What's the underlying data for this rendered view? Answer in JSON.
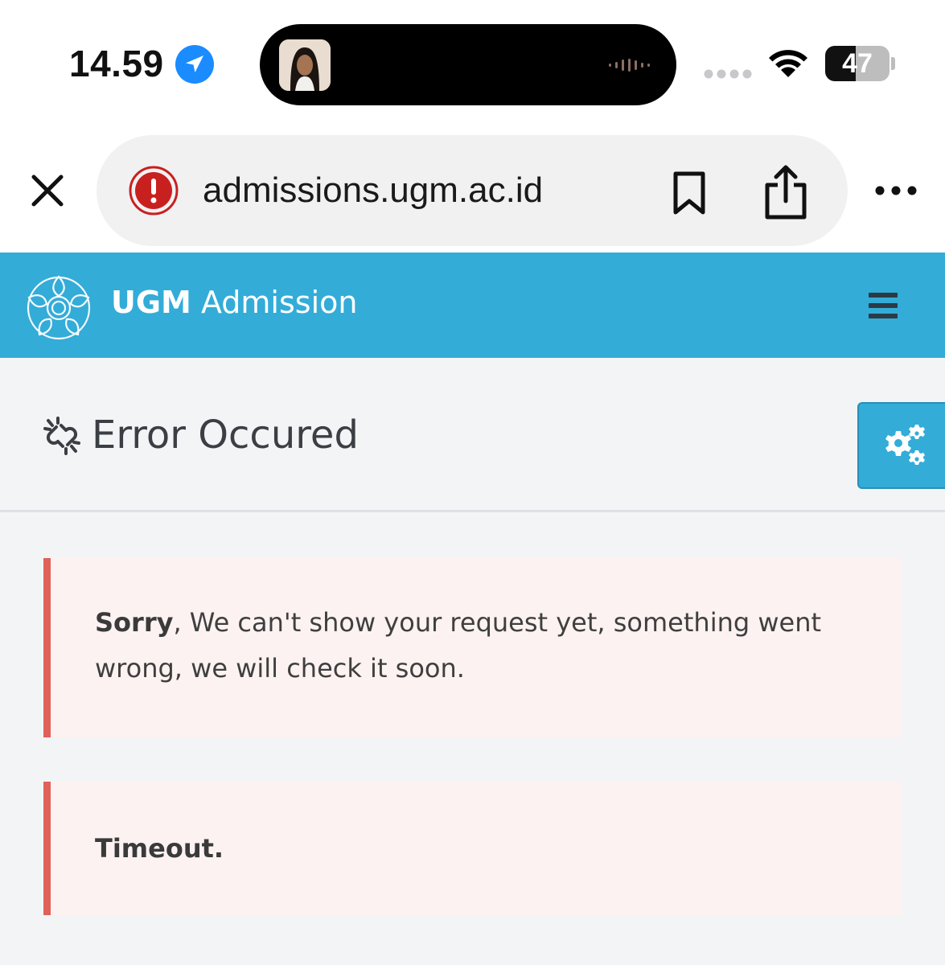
{
  "status_bar": {
    "time": "14.59",
    "battery": "47",
    "battery_level": 0.47,
    "icons": [
      "location-arrow-icon",
      "wifi-icon",
      "battery-icon",
      "signal-dots-icon"
    ]
  },
  "browser": {
    "url": "admissions.ugm.ac.id",
    "icons": [
      "close-icon",
      "warning-icon",
      "bookmark-icon",
      "share-icon",
      "more-icon"
    ],
    "warning_color": "#c8201f"
  },
  "header": {
    "brand_bold": "UGM",
    "brand_rest": " Admission",
    "background_color": "#33acd8",
    "icons": [
      "ugm-logo-icon",
      "hamburger-menu-icon"
    ]
  },
  "page": {
    "title": "Error Occured",
    "icons": [
      "unlink-icon",
      "gears-icon"
    ]
  },
  "alerts": {
    "first_bold": "Sorry",
    "first_text": ", We can't show your request yet, something went wrong, we will check it soon.",
    "second": "Timeout.",
    "border_color": "#e0605a"
  }
}
